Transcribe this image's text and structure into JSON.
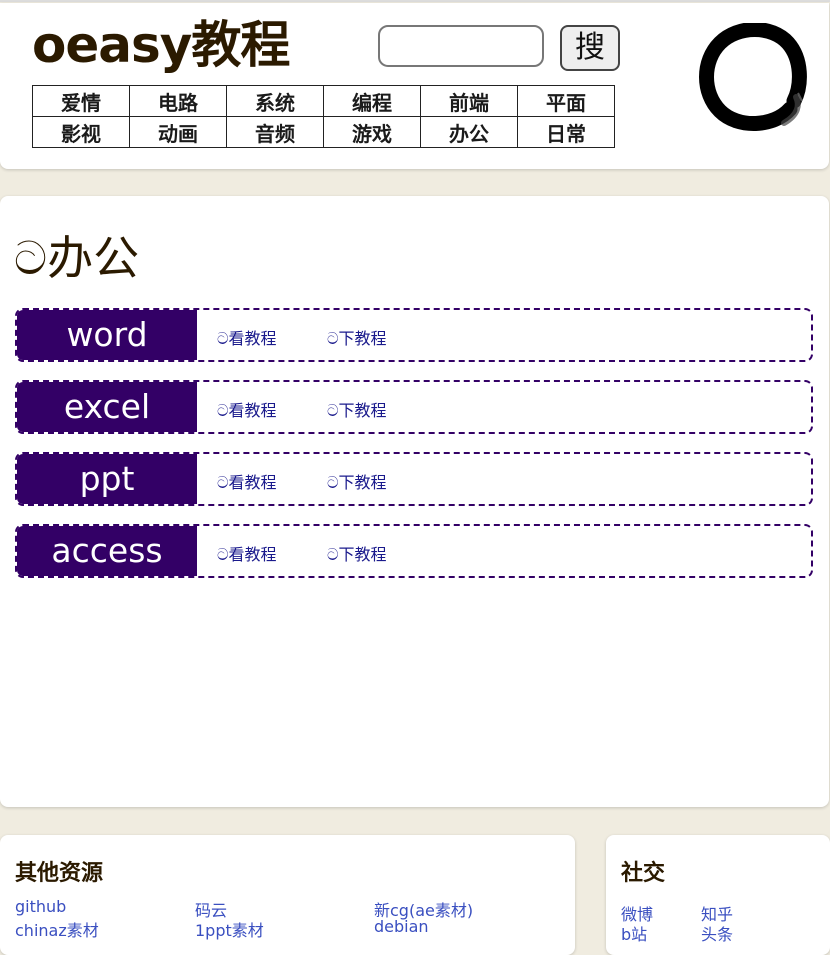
{
  "header": {
    "logo": "oeasy教程",
    "search_button": "搜",
    "search_value": "",
    "nav_rows": [
      [
        "爱情",
        "电路",
        "系统",
        "编程",
        "前端",
        "平面"
      ],
      [
        "影视",
        "动画",
        "音频",
        "游戏",
        "办公",
        "日常"
      ]
    ],
    "enso_icon": "enso-circle-icon"
  },
  "main": {
    "title": "ට办公",
    "courses": [
      {
        "name": "word",
        "view": "ට看教程",
        "download": "ට下教程"
      },
      {
        "name": "excel",
        "view": "ට看教程",
        "download": "ට下教程"
      },
      {
        "name": "ppt",
        "view": "ට看教程",
        "download": "ට下教程"
      },
      {
        "name": "access",
        "view": "ට看教程",
        "download": "ට下教程"
      }
    ]
  },
  "resources": {
    "title": "其他资源",
    "links": [
      "github",
      "码云",
      "新cg(ae素材)",
      "chinaz素材",
      "1ppt素材",
      "debian"
    ]
  },
  "social": {
    "title": "社交",
    "links": [
      "微博",
      "知乎",
      "b站",
      "头条"
    ]
  },
  "colors": {
    "accent": "#330066",
    "link": "#1a1a8c",
    "background": "#f0ece0",
    "text": "#2b1a00"
  }
}
